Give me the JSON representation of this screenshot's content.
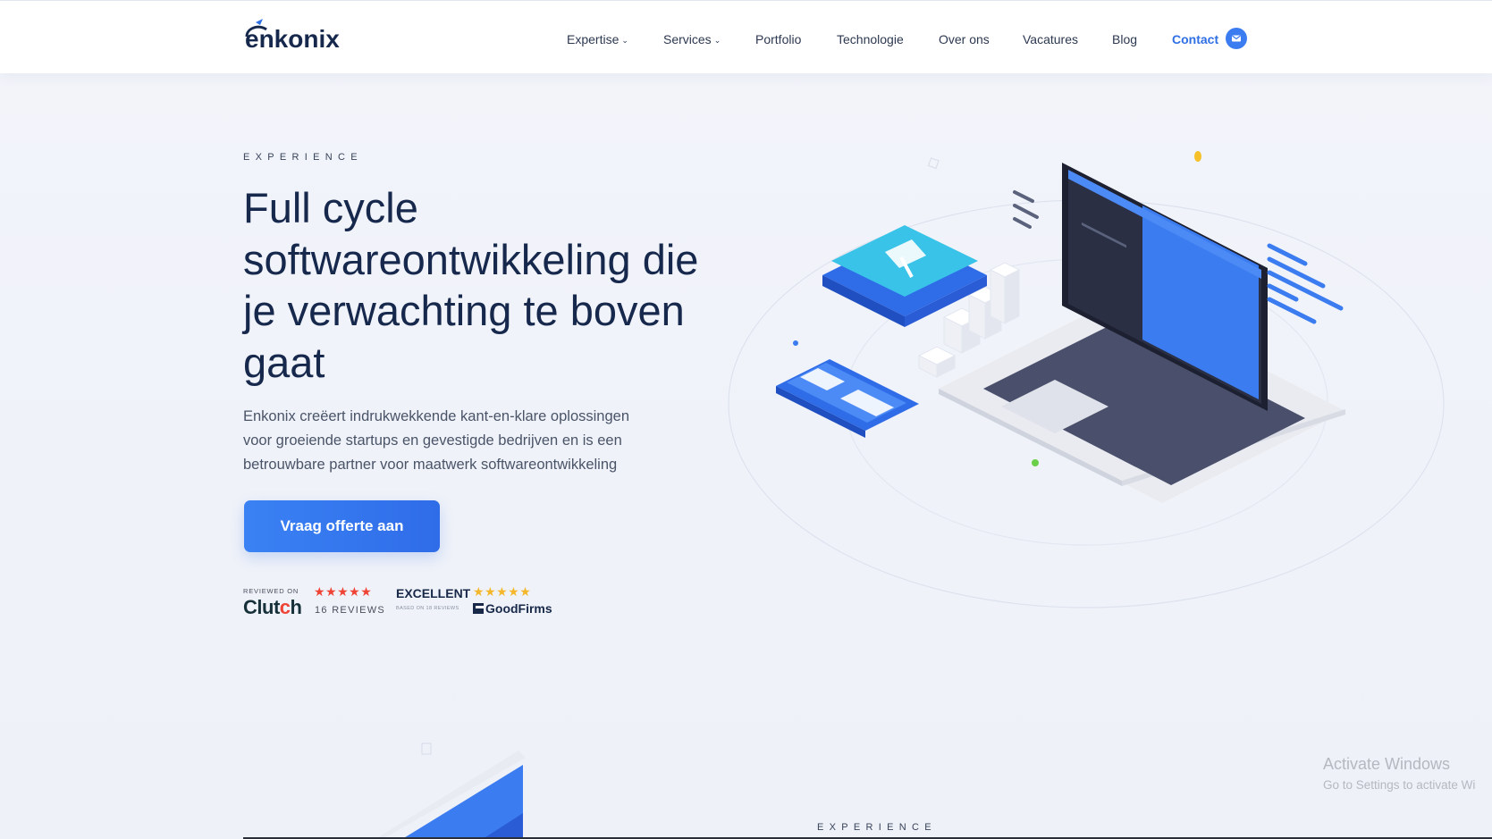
{
  "header": {
    "logo_text": "enkonix",
    "nav": [
      {
        "label": "Expertise",
        "has_caret": true
      },
      {
        "label": "Services",
        "has_caret": true
      },
      {
        "label": "Portfolio"
      },
      {
        "label": "Technologie"
      },
      {
        "label": "Over ons"
      },
      {
        "label": "Vacatures"
      },
      {
        "label": "Blog"
      },
      {
        "label": "Contact"
      }
    ],
    "caret_glyph": "⌄",
    "contact_icon": "mail-icon"
  },
  "hero": {
    "eyebrow": "EXPERIENCE",
    "headline_lines": [
      "Full cycle",
      "softwareontwikkeling die",
      "je verwachting te boven",
      "gaat"
    ],
    "subcopy_lines": [
      "Enkonix creëert indrukwekkende kant-en-klare oplossingen",
      "voor groeiende startups en gevestigde bedrijven en is een",
      "betrouwbare partner voor maatwerk softwareontwikkeling"
    ],
    "cta_label": "Vraag offerte aan"
  },
  "reviews": {
    "clutch": {
      "reviewed_on": "REVIEWED ON",
      "logo_text": "Clutch",
      "stars": "★★★★★",
      "count": "16 REVIEWS"
    },
    "goodfirms": {
      "title": "EXCELLENT",
      "stars": "★★★★★",
      "based_on": "BASED ON 18 REVIEWS",
      "logo_text": "GoodFirms"
    }
  },
  "section2": {
    "eyebrow": "EXPERIENCE"
  },
  "watermark": {
    "title": "Activate Windows",
    "subtitle": "Go to Settings to activate Wi"
  },
  "colors": {
    "accent": "#2f6fe4",
    "headline": "#17284d",
    "clutch_red": "#ef4335",
    "goodfirms_gold": "#f5b72a"
  }
}
